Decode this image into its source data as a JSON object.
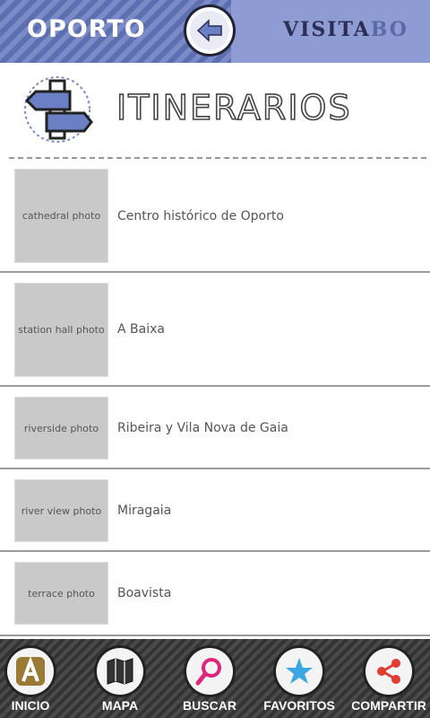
{
  "header": {
    "city": "OPORTO",
    "brand_main": "VISITA",
    "brand_tail": "BO",
    "back_icon": "arrow-left-icon"
  },
  "section": {
    "title": "ITINERARIOS",
    "icon": "signpost-icon"
  },
  "items": [
    {
      "label": "Centro histórico de Oporto",
      "image": "cathedral photo"
    },
    {
      "label": "A Baixa",
      "image": "station hall photo"
    },
    {
      "label": "Ribeira y Vila Nova de Gaia",
      "image": "riverside photo"
    },
    {
      "label": "Miragaia",
      "image": "river view photo"
    },
    {
      "label": "Boavista",
      "image": "terrace photo"
    }
  ],
  "nav": [
    {
      "label": "INICIO",
      "icon": "home-a-icon"
    },
    {
      "label": "MAPA",
      "icon": "map-icon"
    },
    {
      "label": "BUSCAR",
      "icon": "search-icon"
    },
    {
      "label": "FAVORITOS",
      "icon": "star-icon"
    },
    {
      "label": "COMPARTIR",
      "icon": "share-icon"
    }
  ],
  "colors": {
    "header_blue": "#5c6fb0",
    "accent_pink": "#e0247a",
    "accent_cyan": "#3aa7e0"
  }
}
